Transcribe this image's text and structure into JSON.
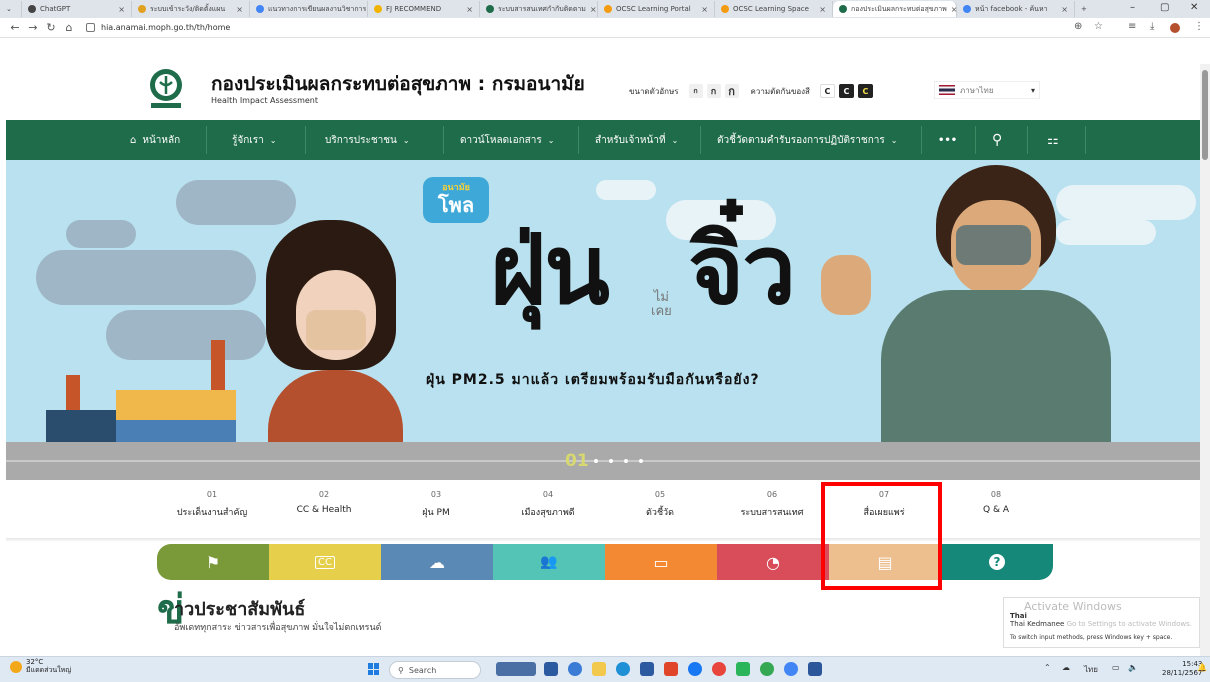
{
  "browser": {
    "tabs": [
      {
        "label": "ChatGPT",
        "color": "#444",
        "active": false
      },
      {
        "label": "ระบบเข้าระวัง/ติดตั้งแผน",
        "color": "#e0a020",
        "active": false
      },
      {
        "label": "แนวทางการเขียนผลงานวิชาการ",
        "color": "#4285f4",
        "active": false
      },
      {
        "label": "FJ RECOMMEND",
        "color": "#f0b400",
        "active": false
      },
      {
        "label": "ระบบสารสนเทศกำกับติดตาม",
        "color": "#1f6c4a",
        "active": false
      },
      {
        "label": "OCSC Learning Portal",
        "color": "#f39c12",
        "active": false
      },
      {
        "label": "OCSC Learning Space",
        "color": "#f39c12",
        "active": false
      },
      {
        "label": "กองประเมินผลกระทบต่อสุขภาพ",
        "color": "#1f6c4a",
        "active": true
      },
      {
        "label": "หน้า facebook - ค้นหา",
        "color": "#4285f4",
        "active": false
      }
    ],
    "url": "hia.anamai.moph.go.th/th/home"
  },
  "site": {
    "title": "กองประเมินผลกระทบต่อสุขภาพ : กรมอนามัย",
    "subtitle": "Health Impact Assessment",
    "font_size_label": "ขนาดตัวอักษร",
    "font_sizes": [
      "ก",
      "ก",
      "ก"
    ],
    "contrast_label": "ความตัดกันของสี",
    "contrast_options": [
      "C",
      "C",
      "C"
    ],
    "language": "ภาษาไทย"
  },
  "menu": {
    "home": "หน้าหลัก",
    "about": "รู้จักเรา",
    "services": "บริการประชาชน",
    "downloads": "ดาวน์โหลดเอกสาร",
    "staff": "สำหรับเจ้าหน้าที่",
    "indicators": "ตัวชี้วัดตามคำรับรองการปฏิบัติราชการ",
    "more": "•••"
  },
  "hero": {
    "logo_top": "อนามัย",
    "logo_main": "โพล",
    "title_left": "ฝุ่น",
    "title_mid": "ไม่\nเคย",
    "title_right": "จิ๋ว",
    "subtitle": "ฝุ่น PM2.5 มาแล้ว เตรียมพร้อมรับมือกันหรือยัง?",
    "slide_number": "01"
  },
  "categories": [
    {
      "num": "01",
      "label": "ประเด็นงานสำคัญ",
      "color": "#7a9a3a",
      "icon": "flag-icon"
    },
    {
      "num": "02",
      "label": "CC & Health",
      "color": "#e6cf4a",
      "icon": "cc-icon"
    },
    {
      "num": "03",
      "label": "ฝุ่น PM",
      "color": "#5a89b5",
      "icon": "cloud-icon"
    },
    {
      "num": "04",
      "label": "เมืองสุขภาพดี",
      "color": "#54c4b6",
      "icon": "people-icon"
    },
    {
      "num": "05",
      "label": "ตัวชี้วัด",
      "color": "#f38a33",
      "icon": "monitor-icon"
    },
    {
      "num": "06",
      "label": "ระบบสารสนเทศ",
      "color": "#d94c5a",
      "icon": "dashboard-icon"
    },
    {
      "num": "07",
      "label": "สื่อเผยแพร่",
      "color": "#edbf8f",
      "icon": "book-icon"
    },
    {
      "num": "08",
      "label": "Q & A",
      "color": "#16887a",
      "icon": "question-icon"
    }
  ],
  "news": {
    "title_initial": "ข่",
    "title_rest": "าวประชาสัมพันธ์",
    "subtitle": "อัพเดททุกสาระ ข่าวสารเพื่อสุขภาพ มั่นใจไม่ตกเทรนด์"
  },
  "windows": {
    "activate_title": "Activate Windows",
    "activate_sub": "Go to Settings to activate Windows.",
    "ime_name": "Thai",
    "ime_layout": "Thai Kedmanee",
    "ime_hint": "To switch input methods, press Windows key + space.",
    "weather_temp": "32°C",
    "weather_desc": "มีแดดส่วนใหญ่",
    "search_label": "Search",
    "time": "15:43",
    "date": "28/11/2567",
    "lang_indicator": "ไทย"
  }
}
